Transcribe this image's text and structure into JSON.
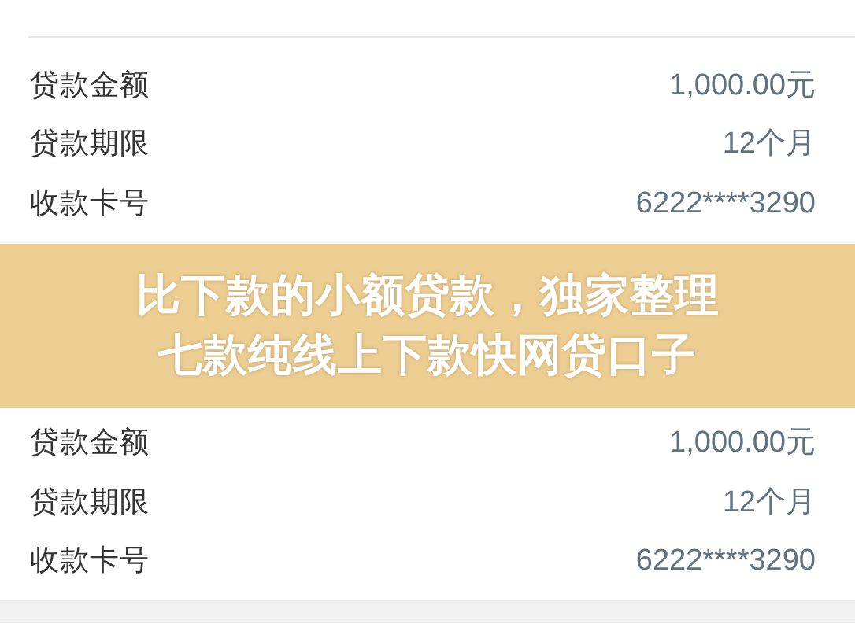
{
  "loan_cards": [
    {
      "rows": [
        {
          "label": "贷款金额",
          "value": "1,000.00元"
        },
        {
          "label": "贷款期限",
          "value": "12个月"
        },
        {
          "label": "收款卡号",
          "value": "6222****3290"
        }
      ]
    },
    {
      "rows": [
        {
          "label": "贷款金额",
          "value": "1,000.00元"
        },
        {
          "label": "贷款期限",
          "value": "12个月"
        },
        {
          "label": "收款卡号",
          "value": "6222****3290"
        }
      ]
    }
  ],
  "banner": {
    "lines": [
      "比下款的小额贷款，独家整理",
      "七款纯线上下款快网贷口子"
    ]
  }
}
